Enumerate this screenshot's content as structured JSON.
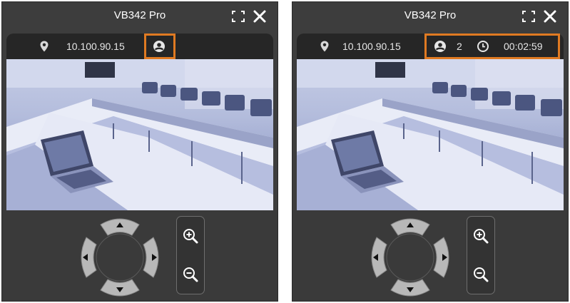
{
  "left_panel": {
    "title": "VB342 Pro",
    "ip_address": "10.100.90.15",
    "icons": {
      "location": "location-pin-icon",
      "user": "user-icon",
      "expand": "fullscreen-icon",
      "close": "close-icon"
    }
  },
  "right_panel": {
    "title": "VB342 Pro",
    "ip_address": "10.100.90.15",
    "user_count": "2",
    "duration": "00:02:59",
    "icons": {
      "location": "location-pin-icon",
      "user": "user-icon",
      "clock": "clock-icon",
      "expand": "fullscreen-icon",
      "close": "close-icon"
    }
  },
  "colors": {
    "highlight": "#e07a22",
    "window": "#3d3d3d",
    "infobar": "#262626"
  }
}
